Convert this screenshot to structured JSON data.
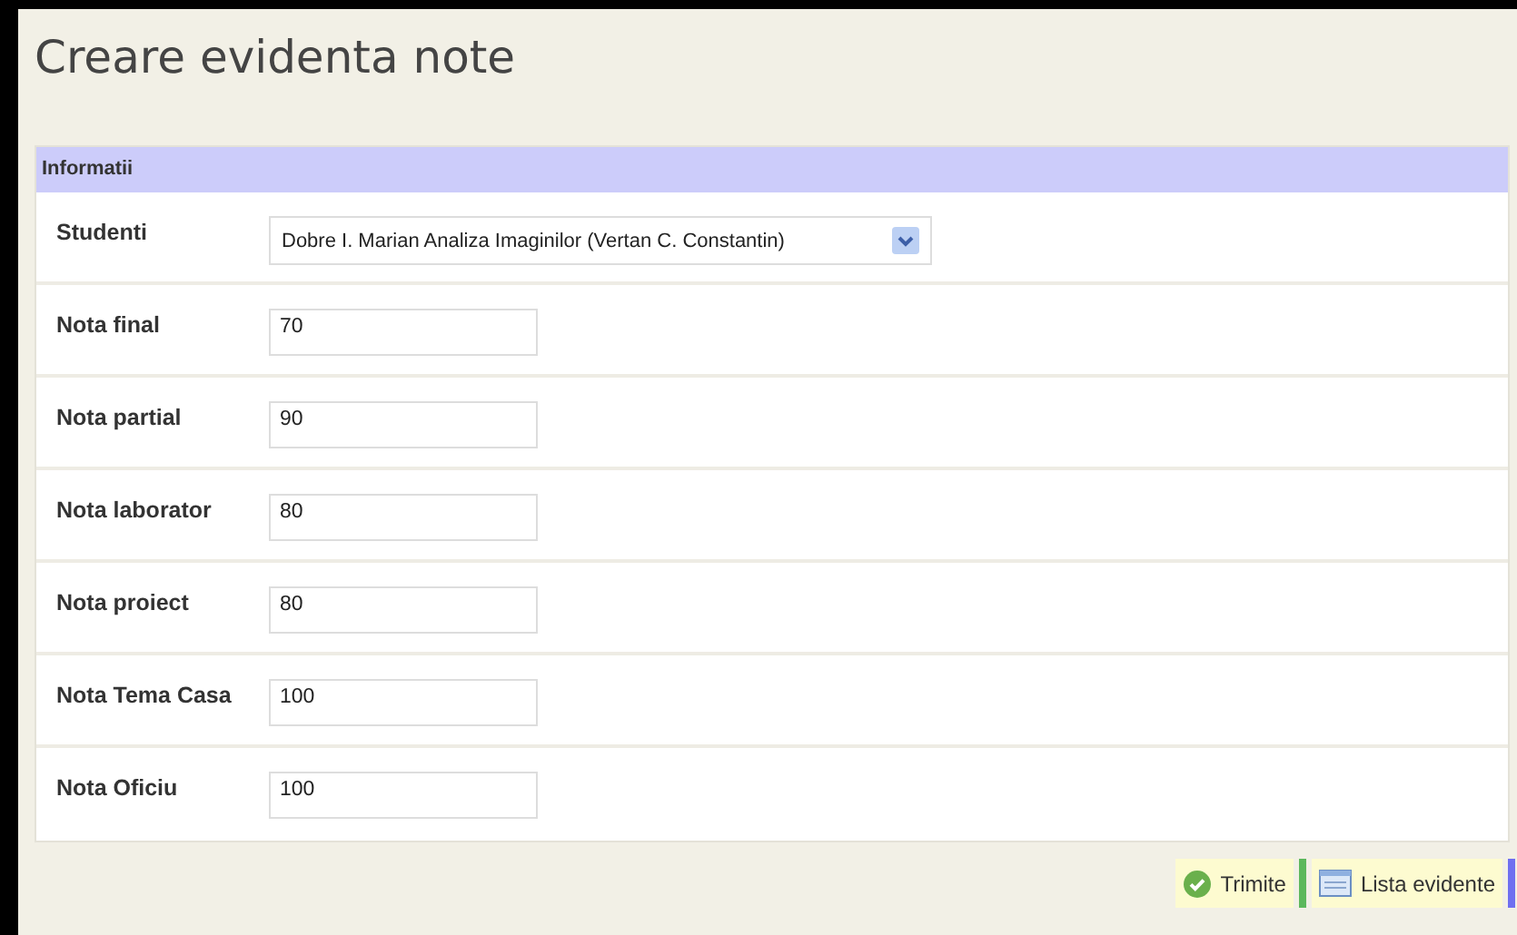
{
  "title": "Creare evidenta note",
  "section": {
    "title": "Informatii"
  },
  "fields": [
    {
      "kind": "select",
      "label": "Studenti",
      "value": "Dobre I. Marian Analiza Imaginilor (Vertan C. Constantin)"
    },
    {
      "kind": "text",
      "label": "Nota final",
      "value": "70"
    },
    {
      "kind": "text",
      "label": "Nota partial",
      "value": "90"
    },
    {
      "kind": "text",
      "label": "Nota laborator",
      "value": "80"
    },
    {
      "kind": "text",
      "label": "Nota proiect",
      "value": "80"
    },
    {
      "kind": "text",
      "label": "Nota Tema Casa",
      "value": "100"
    },
    {
      "kind": "text",
      "label": "Nota Oficiu",
      "value": "100"
    }
  ],
  "buttons": [
    {
      "kind": "submit",
      "label": "Trimite",
      "color": "#5cb85c"
    },
    {
      "kind": "list",
      "label": "Lista evidente",
      "color": "#6f6ff0"
    }
  ]
}
